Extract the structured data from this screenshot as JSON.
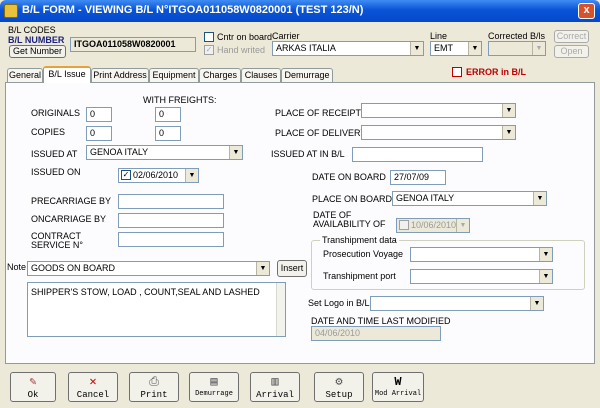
{
  "window": {
    "title": "B/L FORM - VIEWING B/L N°ITGOA011058W0820001     (TEST 123/N)",
    "close_glyph": "x"
  },
  "header": {
    "bl_codes_label": "B/L CODES",
    "bl_number_label": "B/L NUMBER",
    "bl_number_value": "ITGOA011058W0820001",
    "get_number_label": "Get Number",
    "cntr_on_board_label": "Cntr on board",
    "hand_writed_label": "Hand writed",
    "hand_writed_check": "✓",
    "carrier_label": "Carrier",
    "carrier_value": "ARKAS ITALIA",
    "line_label": "Line",
    "line_value": "EMT",
    "corrected_bls_label": "Corrected B/ls",
    "corrected_bls_value": "",
    "correct_label": "Correct",
    "open_label": "Open"
  },
  "tabs": [
    {
      "label": "General"
    },
    {
      "label": "B/L Issue"
    },
    {
      "label": "Print Address"
    },
    {
      "label": "Equipment"
    },
    {
      "label": "Charges"
    },
    {
      "label": "Clauses"
    },
    {
      "label": "Demurrage"
    }
  ],
  "active_tab": "B/L Issue",
  "error": {
    "label": "ERROR in B/L"
  },
  "form": {
    "with_freights_label": "WITH FREIGHTS:",
    "originals_label": "ORIGINALS",
    "originals_value": "0",
    "originals_freight_value": "0",
    "copies_label": "COPIES",
    "copies_value": "0",
    "copies_freight_value": "0",
    "issued_at_label": "ISSUED AT",
    "issued_at_value": "GENOA ITALY",
    "issued_on_label": "ISSUED ON",
    "issued_on_value": "02/06/2010",
    "issued_on_check": "✓",
    "precarriage_label": "PRECARRIAGE BY",
    "precarriage_value": "",
    "oncarriage_label": "ONCARRIAGE BY",
    "oncarriage_value": "",
    "contract_label_1": "CONTRACT",
    "contract_label_2": "SERVICE N°",
    "contract_value": "",
    "place_of_receipt_label": "PLACE OF RECEIPT",
    "place_of_receipt_value": "",
    "place_of_delivery_label": "PLACE OF DELIVERY",
    "place_of_delivery_value": "",
    "issued_at_in_bl_label": "ISSUED AT IN B/L",
    "issued_at_in_bl_value": "",
    "date_on_board_label": "DATE ON BOARD",
    "date_on_board_value": "27/07/09",
    "place_on_board_label": "PLACE ON BOARD",
    "place_on_board_value": "GENOA ITALY",
    "date_of_label_1": "DATE OF",
    "date_of_label_2": "AVAILABILITY OF",
    "availability_value": "10/06/2010",
    "transhipment_title": "Transhipment data",
    "prosecution_voyage_label": "Prosecution Voyage",
    "prosecution_voyage_value": "",
    "transhipment_port_label": "Transhipment port",
    "transhipment_port_value": "",
    "note_label": "Note",
    "note_value": "GOODS ON BOARD",
    "insert_label": "Insert",
    "note_text": "SHIPPER'S STOW, LOAD , COUNT,SEAL AND LASHED",
    "set_logo_label": "Set Logo in B/L",
    "set_logo_value": "",
    "last_modified_label": "DATE AND TIME LAST MODIFIED",
    "last_modified_value": "04/06/2010"
  },
  "toolbar": {
    "ok": "Ok",
    "cancel": "Cancel",
    "print": "Print",
    "demurrage": "Demurrage",
    "arrival": "Arrival",
    "setup": "Setup",
    "mod_arrival": "Mod Arrival"
  },
  "colors": {
    "title_bar": "#0a54d8",
    "error_text": "#c00000",
    "label_navy": "#1a237e",
    "active_tab_accent": "#e8a13a"
  }
}
